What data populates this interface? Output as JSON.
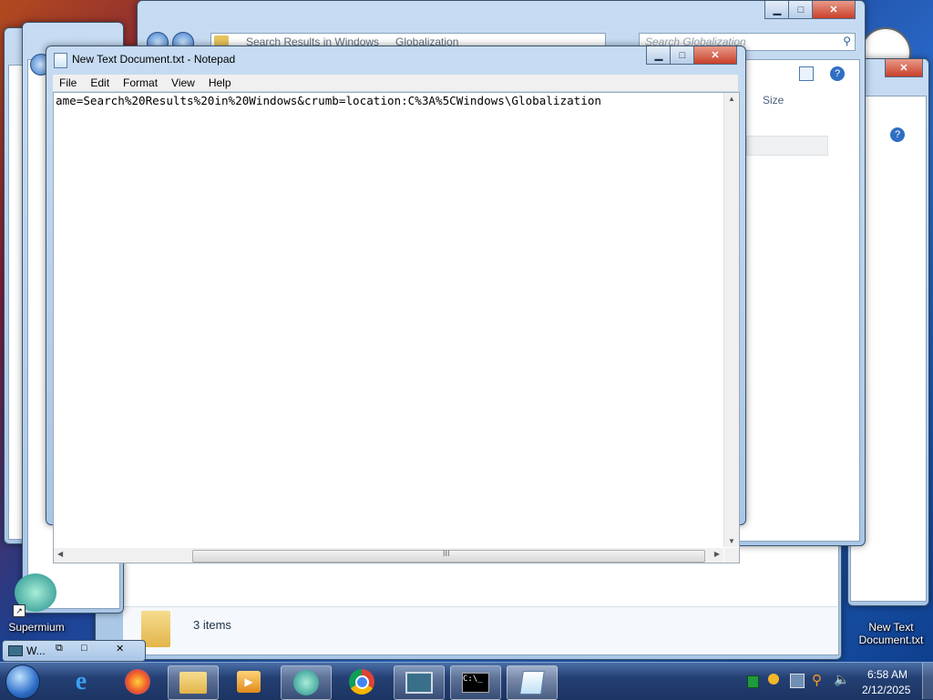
{
  "notepad": {
    "title": "New Text Document.txt - Notepad",
    "menu": [
      "File",
      "Edit",
      "Format",
      "View",
      "Help"
    ],
    "content": "ame=Search%20Results%20in%20Windows&crumb=location:C%3A%5CWindows\\Globalization",
    "scroll_grip": "III"
  },
  "explorer_front": {
    "breadcrumb": [
      "Search Results in Windows",
      "Globalization"
    ],
    "search_placeholder": "Search Globalization",
    "column_size": "Size"
  },
  "explorer_back": {
    "status_items": "3 items"
  },
  "mini_window": {
    "label": "W..."
  },
  "desktop": {
    "icons": [
      {
        "label": "Supermium"
      },
      {
        "label": "New Text Document.txt"
      }
    ]
  },
  "taskbar": {
    "buttons": [
      "start-orb",
      "internet-explorer",
      "firefox",
      "file-explorer",
      "media-player",
      "supermium",
      "chrome",
      "remote-desktop",
      "command-prompt",
      "notepad"
    ],
    "clock_time": "6:58 AM",
    "clock_date": "2/12/2025"
  },
  "colors": {
    "title_glass": "#b9d1ec",
    "taskbar": "#243f73",
    "close_red": "#c8402a"
  }
}
